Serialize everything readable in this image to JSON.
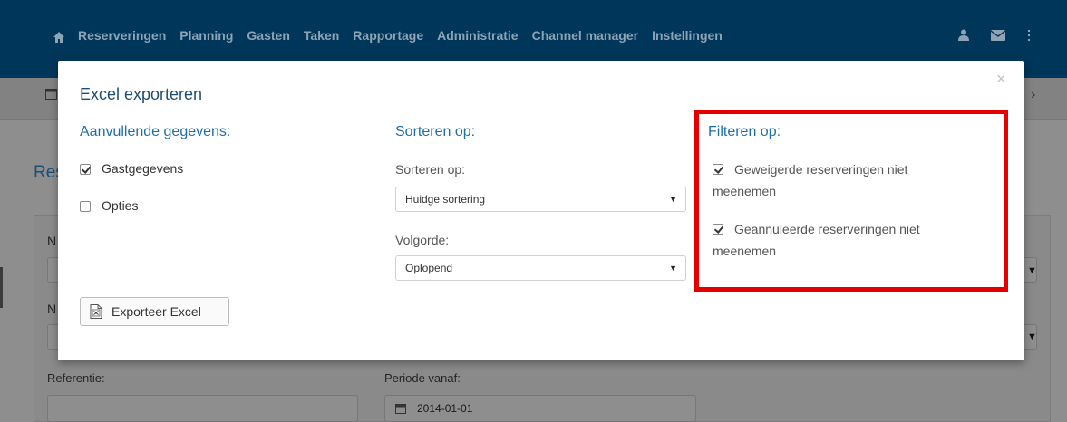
{
  "nav": {
    "home_icon": "home-icon",
    "items": [
      "Reserveringen",
      "Planning",
      "Gasten",
      "Taken",
      "Rapportage",
      "Administratie",
      "Channel manager",
      "Instellingen"
    ],
    "right_icons": [
      "user-icon",
      "envelope-icon",
      "more-vertical-icon"
    ]
  },
  "background": {
    "section_title": "Res",
    "letter_1": "N",
    "letter_2": "N",
    "reference_label": "Referentie:",
    "period_label": "Periode vanaf:",
    "period_value": "2014-01-01"
  },
  "modal": {
    "title": "Excel exporteren",
    "close": "×",
    "extra": {
      "title": "Aanvullende gegevens:",
      "options": [
        {
          "label": "Gastgegevens",
          "checked": true
        },
        {
          "label": "Opties",
          "checked": false
        }
      ]
    },
    "sort": {
      "title": "Sorteren op:",
      "sort_label": "Sorteren op:",
      "sort_value": "Huidge sortering",
      "order_label": "Volgorde:",
      "order_value": "Oplopend"
    },
    "filter": {
      "title": "Filteren op:",
      "opt1_line1": "Geweigerde reserveringen niet",
      "opt1_line2": "meenemen",
      "opt2_line1": "Geannuleerde reserveringen niet",
      "opt2_line2": "meenemen"
    },
    "export_button": "Exporteer Excel"
  },
  "colors": {
    "nav_bg": "#003659",
    "title_blue": "#1e4f73",
    "link_blue": "#1e6fa6",
    "highlight": "#e50000"
  }
}
